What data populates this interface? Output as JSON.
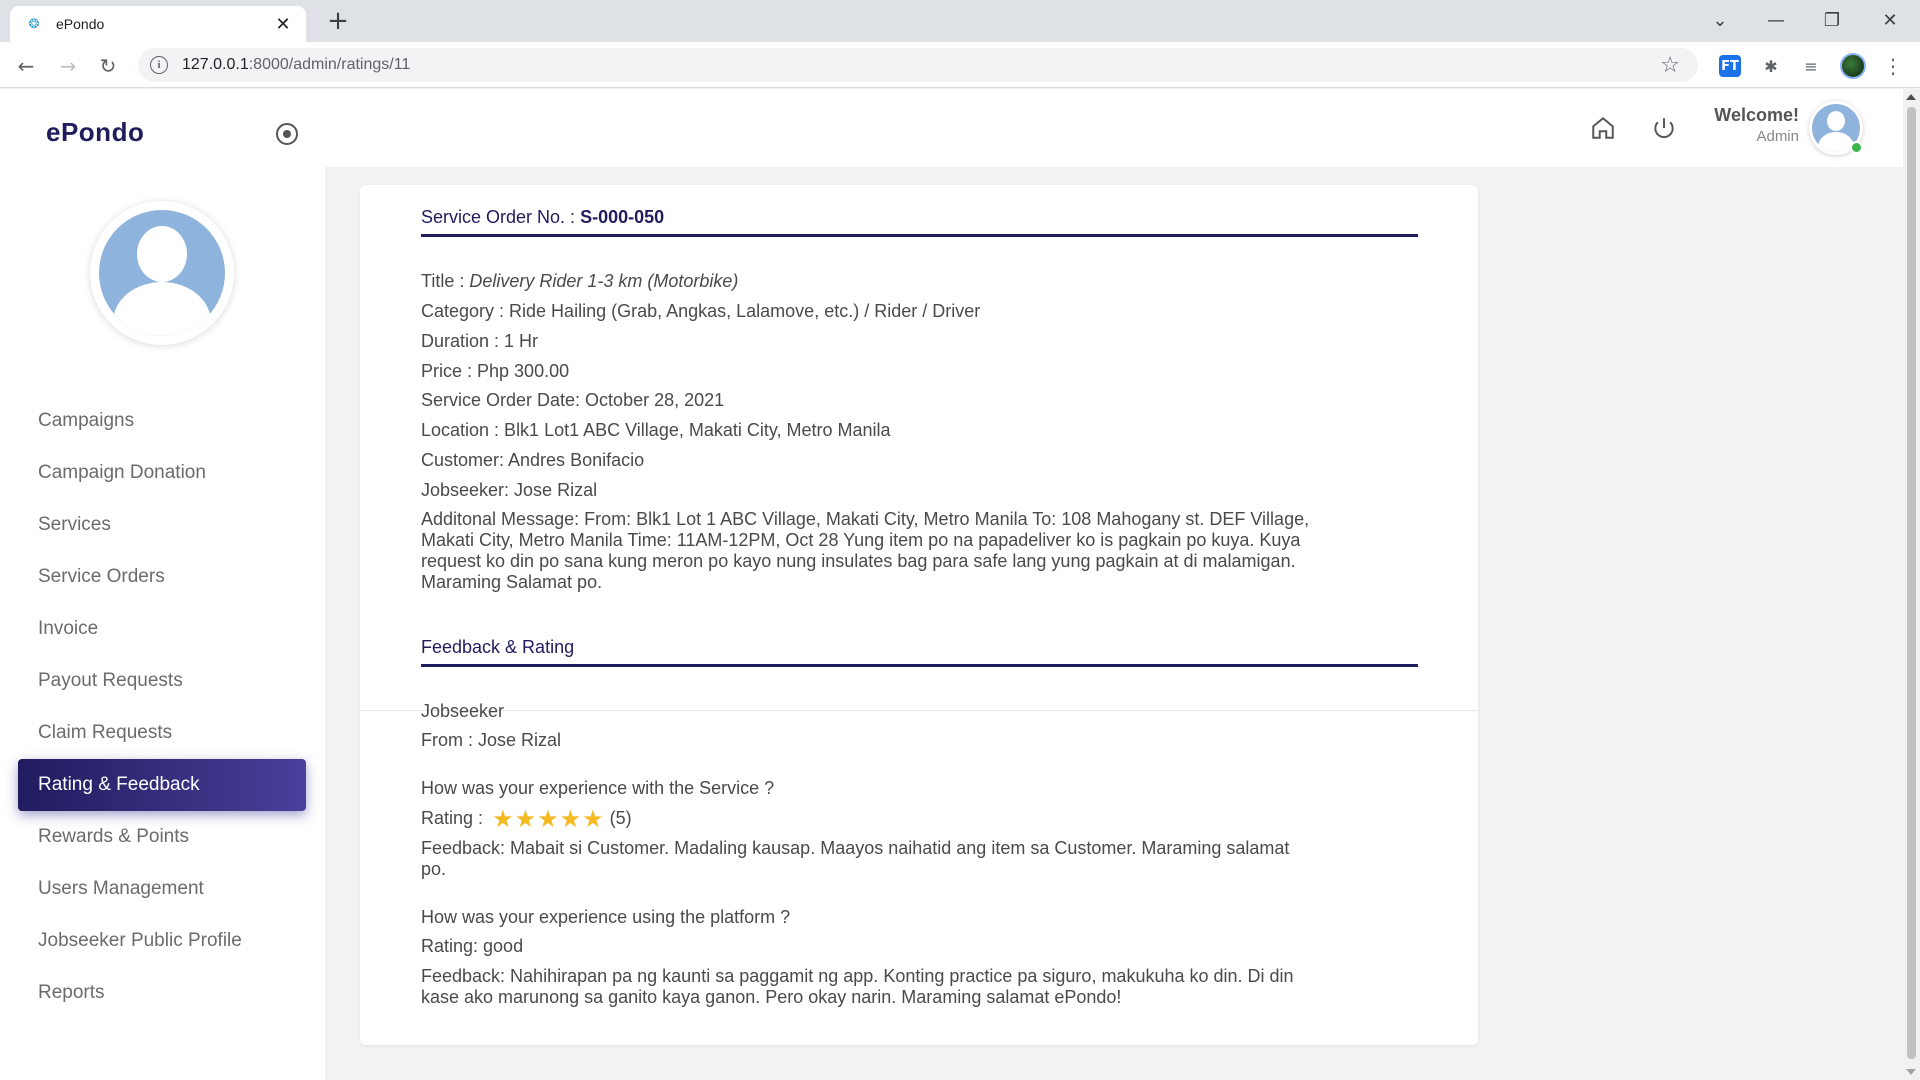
{
  "browser": {
    "tab_title": "ePondo",
    "url_host": "127.0.0.1",
    "url_rest": ":8000/admin/ratings/11"
  },
  "sidebar": {
    "brand": "ePondo",
    "items": [
      {
        "label": "Campaigns"
      },
      {
        "label": "Campaign Donation"
      },
      {
        "label": "Services"
      },
      {
        "label": "Service Orders"
      },
      {
        "label": "Invoice"
      },
      {
        "label": "Payout Requests"
      },
      {
        "label": "Claim Requests"
      },
      {
        "label": "Rating & Feedback",
        "active": true
      },
      {
        "label": "Rewards & Points"
      },
      {
        "label": "Users Management"
      },
      {
        "label": "Jobseeker Public Profile"
      },
      {
        "label": "Reports"
      }
    ]
  },
  "topbar": {
    "welcome": "Welcome!",
    "role": "Admin"
  },
  "order": {
    "heading_label": "Service Order No. :",
    "number": "S-000-050",
    "title_label": "Title :",
    "title_value": "Delivery Rider 1-3 km (Motorbike)",
    "category": "Category : Ride Hailing (Grab, Angkas, Lalamove, etc.) / Rider / Driver",
    "duration": "Duration : 1 Hr",
    "price": "Price : Php 300.00",
    "date": "Service Order Date: October 28, 2021",
    "location": "Location : Blk1 Lot1 ABC Village, Makati City, Metro Manila",
    "customer": "Customer: Andres Bonifacio",
    "jobseeker": "Jobseeker: Jose Rizal",
    "message_line1": "Additonal Message: From: Blk1 Lot 1 ABC Village, Makati City, Metro Manila To: 108 Mahogany st. DEF Village,",
    "message_line2": "Makati City, Metro Manila Time: 11AM-12PM, Oct 28 Yung item po na papadeliver ko is pagkain po kuya. Kuya",
    "message_line3": "request ko din po sana kung meron po kayo nung insulates bag para safe lang yung pagkain at di malamigan.",
    "message_line4": "Maraming Salamat po."
  },
  "feedback": {
    "heading": "Feedback & Rating",
    "role": "Jobseeker",
    "from": "From : Jose Rizal",
    "q_service": "How was your experience with the Service ?",
    "rating_label": "Rating :",
    "rating_stars": 5,
    "rating_count": "(5)",
    "feedback_service_line1": "Feedback: Mabait si Customer. Madaling kausap. Maayos naihatid ang item sa Customer. Maraming salamat",
    "feedback_service_line2": "po.",
    "q_platform": "How was your experience using the platform ?",
    "platform_rating": "Rating: good",
    "feedback_platform_line1": "Feedback: Nahihirapan pa ng kaunti sa paggamit ng app. Konting practice pa siguro, makukuha ko din. Di din",
    "feedback_platform_line2": "kase ako marunong sa ganito kaya ganon. Pero okay narin. Maraming salamat ePondo!"
  },
  "colors": {
    "brand": "#201c5e",
    "active_gradient_end": "#4a3f9a",
    "star": "#f5b921",
    "online": "#3ab54a"
  }
}
